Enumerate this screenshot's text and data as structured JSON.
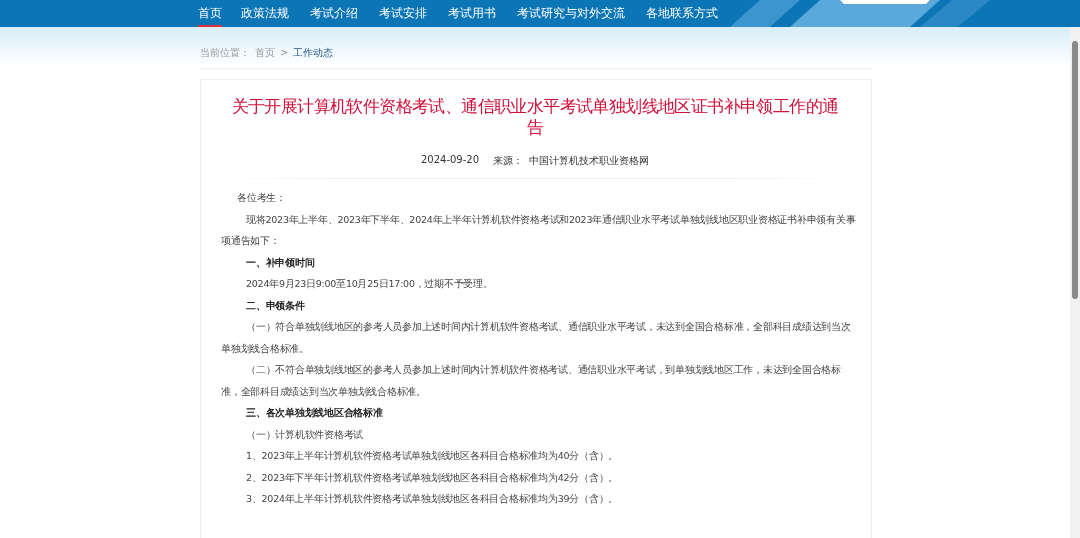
{
  "nav": [
    {
      "label": "首页",
      "selected": true
    },
    {
      "label": "政策法规",
      "selected": false
    },
    {
      "label": "考试介绍",
      "selected": false
    },
    {
      "label": "考试安排",
      "selected": false
    },
    {
      "label": "考试用书",
      "selected": false
    },
    {
      "label": "考试研究与对外交流",
      "selected": false
    },
    {
      "label": "各地联系方式",
      "selected": false
    }
  ],
  "breadcrumb": {
    "label": "当前位置：",
    "items": [
      "首页",
      "工作动态"
    ],
    "separator": ">"
  },
  "article": {
    "title": "关于开展计算机软件资格考试、通信职业水平考试单独划线地区证书补申领工作的通告",
    "date": "2024-09-20",
    "source_label": "来源：",
    "source": "中国计算机技术职业资格网",
    "paragraphs": [
      {
        "kind": "salutation",
        "text": "各位考生："
      },
      {
        "kind": "text",
        "text": "现将2023年上半年、2023年下半年、2024年上半年计算机软件资格考试和2023年通信职业水平考试单独划线地区职业资格证书补申领有关事项通告如下："
      },
      {
        "kind": "heading",
        "text": "一、补申领时间"
      },
      {
        "kind": "text",
        "text": "2024年9月23日9:00至10月25日17:00，过期不予受理。"
      },
      {
        "kind": "heading",
        "text": "二、申领条件"
      },
      {
        "kind": "text",
        "text": "（一）符合单独划线地区的参考人员参加上述时间内计算机软件资格考试、通信职业水平考试，未达到全国合格标准，全部科目成绩达到当次单独划线合格标准。"
      },
      {
        "kind": "text",
        "text": "（二）不符合单独划线地区的参考人员参加上述时间内计算机软件资格考试、通信职业水平考试，到单独划线地区工作，未达到全国合格标准，全部科目成绩达到当次单独划线合格标准。"
      },
      {
        "kind": "heading",
        "text": "三、各次单独划线地区合格标准"
      },
      {
        "kind": "text",
        "text": "（一）计算机软件资格考试"
      },
      {
        "kind": "text",
        "text": "1、2023年上半年计算机软件资格考试单独划线地区各科目合格标准均为40分（含）。"
      },
      {
        "kind": "text",
        "text": "2、2023年下半年计算机软件资格考试单独划线地区各科目合格标准均为42分（含）。"
      },
      {
        "kind": "text",
        "text": "3、2024年上半年计算机软件资格考试单独划线地区各科目合格标准均为39分（含）。"
      }
    ]
  }
}
